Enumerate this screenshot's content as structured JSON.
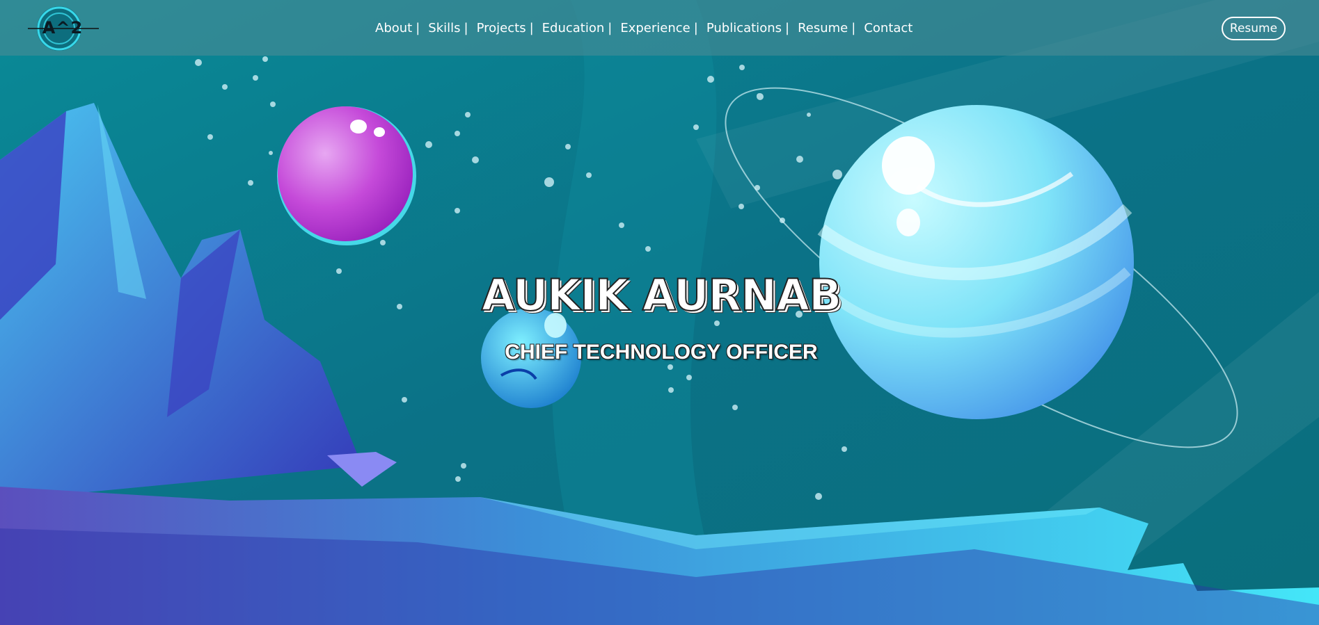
{
  "logo": {
    "text": "A^2"
  },
  "nav": {
    "items": [
      {
        "label": "About"
      },
      {
        "label": "Skills"
      },
      {
        "label": "Projects"
      },
      {
        "label": "Education"
      },
      {
        "label": "Experience"
      },
      {
        "label": "Publications"
      },
      {
        "label": "Resume"
      },
      {
        "label": "Contact"
      }
    ],
    "separator": "|"
  },
  "resume_button": {
    "label": "Resume"
  },
  "hero": {
    "name": "AUKIK AURNAB",
    "title": "CHIEF TECHNOLOGY OFFICER"
  },
  "colors": {
    "background": "#0c7f8f",
    "navbar": "#4f8c96",
    "planet_pink": "#c61fd6",
    "planet_cyan": "#7eeaf5",
    "rocks": "#3b49c8",
    "ground": "#3ad4f0"
  }
}
